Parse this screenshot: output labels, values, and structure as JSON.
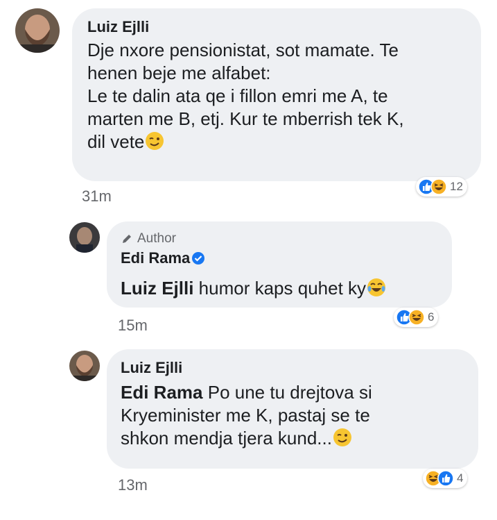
{
  "comments": [
    {
      "author": "Luiz Ejlli",
      "lines": [
        "Dje nxore pensionistat, sot mamate. Te",
        "henen beje me alfabet:",
        "Le te dalin ata qe i fillon emri me A, te",
        "marten me B, etj. Kur te mberrish tek K,",
        "dil vete"
      ],
      "time": "31m",
      "reaction_count": "12",
      "reactions": [
        "like-icon",
        "haha-icon"
      ]
    },
    {
      "author_badge": "Author",
      "author": "Edi Rama",
      "mention": "Luiz Ejlli",
      "text": " humor kaps quhet ky",
      "time": "15m",
      "reaction_count": "6",
      "reactions": [
        "like-icon",
        "haha-icon"
      ]
    },
    {
      "author": "Luiz Ejlli",
      "mention": "Edi Rama",
      "lines": [
        " Po une tu drejtova si",
        "Kryeminister me K, pastaj se te",
        "shkon mendja tjera kund..."
      ],
      "time": "13m",
      "reaction_count": "4",
      "reactions": [
        "haha-icon",
        "like-icon"
      ]
    }
  ],
  "colors": {
    "bubble": "#eef0f3",
    "like_blue": "#1877f2",
    "haha_yellow": "#f7b125",
    "meta_gray": "#65676b"
  }
}
